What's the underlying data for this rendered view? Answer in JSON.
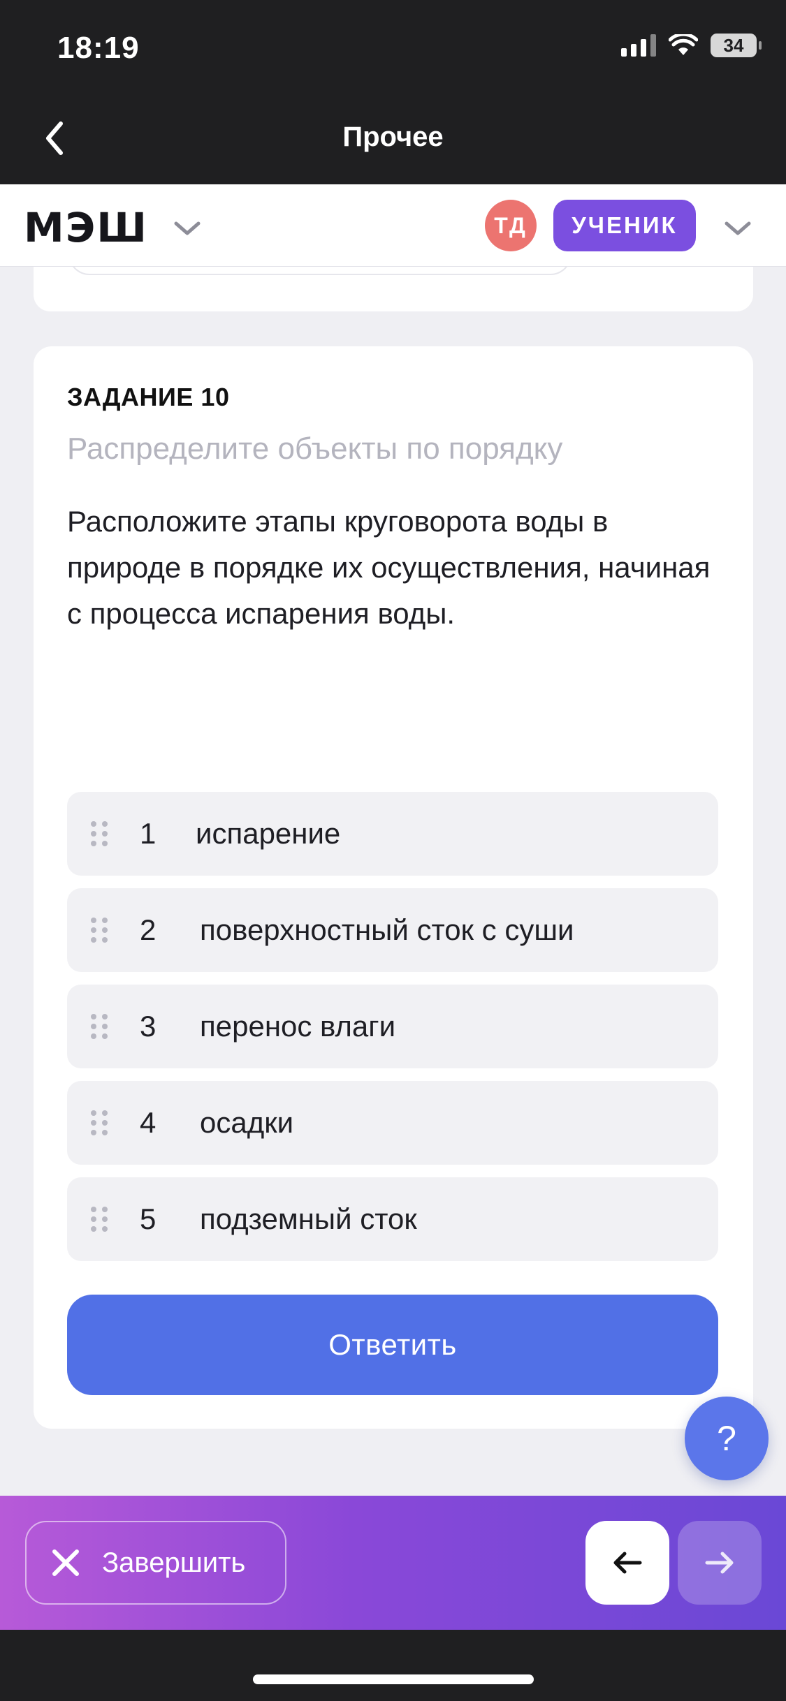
{
  "status_bar": {
    "time": "18:19",
    "battery": "34"
  },
  "nav": {
    "title": "Прочее",
    "back_icon": "chevron-left-icon"
  },
  "app_header": {
    "logo": "МЭШ",
    "avatar_initials": "ТД",
    "role": "УЧЕНИК"
  },
  "task": {
    "number_label": "ЗАДАНИЕ 10",
    "type": "Распределите объекты по порядку",
    "text": "Расположите этапы круговорота воды в природе в порядке их осуществления, начиная с процесса испарения воды.",
    "items": [
      {
        "num": "1",
        "label": "испарение"
      },
      {
        "num": "2",
        "label": "поверхностный сток с суши"
      },
      {
        "num": "3",
        "label": "перенос влаги"
      },
      {
        "num": "4",
        "label": "осадки"
      },
      {
        "num": "5",
        "label": "подземный сток"
      }
    ],
    "answer_label": "Ответить"
  },
  "help": {
    "label": "?"
  },
  "bottom_bar": {
    "finish_label": "Завершить",
    "prev_icon": "arrow-left-icon",
    "next_icon": "arrow-right-icon"
  },
  "colors": {
    "accent": "#5170e6",
    "role": "#7b4fe0",
    "avatar": "#ec7470",
    "bottom_gradient_start": "#b75ad8",
    "bottom_gradient_end": "#6a48d6"
  }
}
